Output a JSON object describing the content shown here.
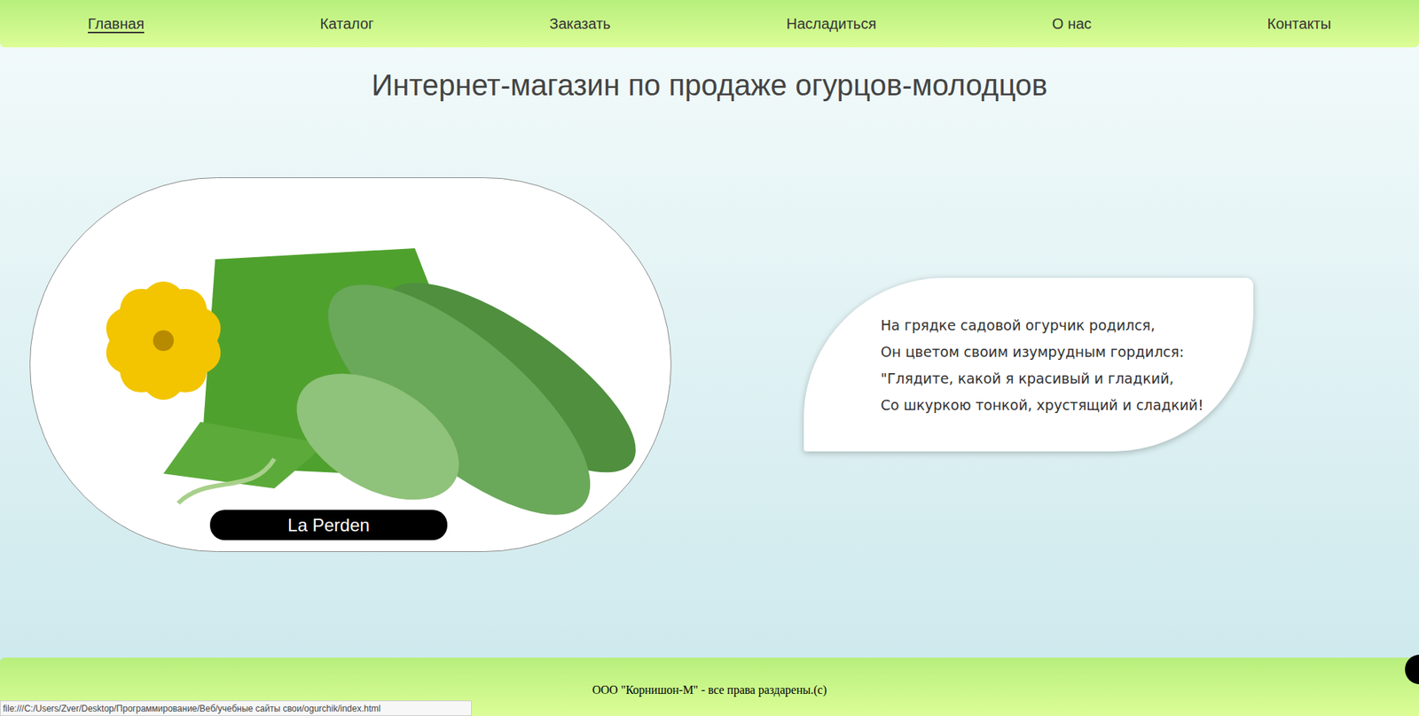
{
  "nav": [
    {
      "label": "Главная",
      "selected": true
    },
    {
      "label": "Каталог",
      "selected": false
    },
    {
      "label": "Заказать",
      "selected": false
    },
    {
      "label": "Насладиться",
      "selected": false
    },
    {
      "label": "О нас",
      "selected": false
    },
    {
      "label": "Контакты",
      "selected": false
    }
  ],
  "title": "Интернет-магазин по продаже огурцов-молодцов",
  "hero": {
    "caption": "La Perden"
  },
  "poem": [
    "На грядке садовой огурчик родился,",
    "Он цветом своим изумрудным гордился:",
    "\"Глядите, какой я красивый и гладкий,",
    "Со шкуркою тонкой, хрустящий и сладкий!"
  ],
  "footer": "ООО \"Корнишон-М\" - все права раздарены.(c)",
  "status_bar": "file:///C:/Users/Zver/Desktop/Программирование/Веб/учебные сайты свои/ogurchik/index.html"
}
